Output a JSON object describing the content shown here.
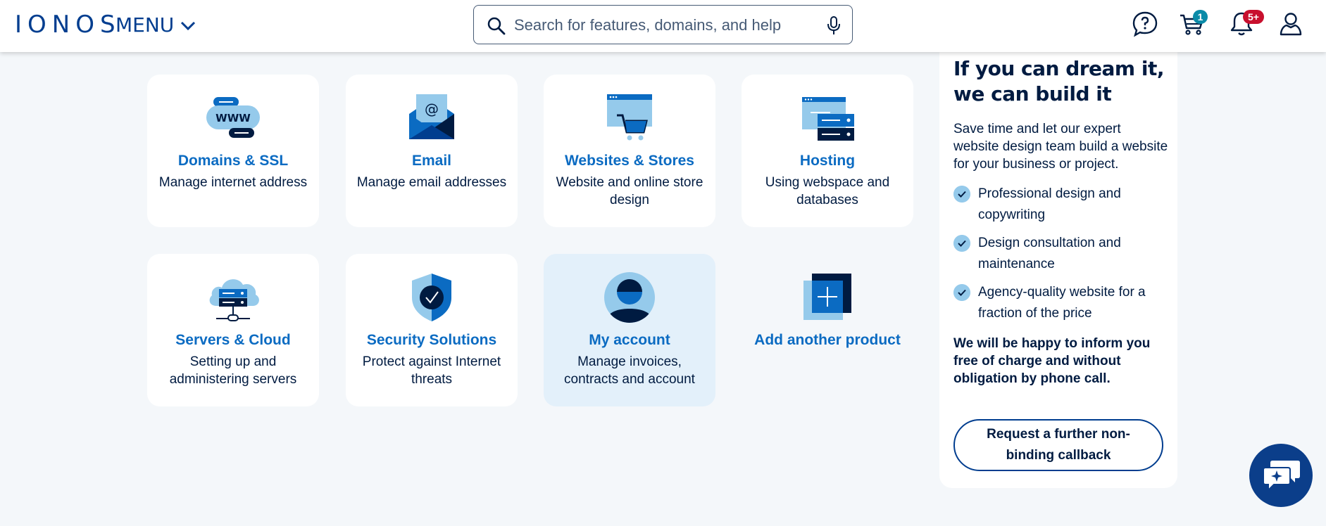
{
  "header": {
    "logo": "IONOS",
    "menu_label": "MENU",
    "search_placeholder": "Search for features, domains, and help",
    "cart_badge": "1",
    "notifications_badge": "5+"
  },
  "tiles": [
    {
      "title": "Domains & SSL",
      "desc": "Manage internet address",
      "icon": "domains-icon"
    },
    {
      "title": "Email",
      "desc": "Manage email addresses",
      "icon": "email-icon"
    },
    {
      "title": "Websites & Stores",
      "desc": "Website and online store design",
      "icon": "website-store-icon"
    },
    {
      "title": "Hosting",
      "desc": "Using webspace and databases",
      "icon": "hosting-icon"
    },
    {
      "title": "Servers & Cloud",
      "desc": "Setting up and administering servers",
      "icon": "server-cloud-icon"
    },
    {
      "title": "Security Solutions",
      "desc": "Protect against Internet threats",
      "icon": "security-shield-icon"
    },
    {
      "title": "My account",
      "desc": "Manage invoices, contracts and account",
      "icon": "account-icon"
    },
    {
      "title": "Add another product",
      "desc": "",
      "icon": "add-product-icon"
    }
  ],
  "promo": {
    "heading": "If you can dream it, we can build it",
    "intro": "Save time and let our expert website design team build a website for your business or project.",
    "bullets": [
      "Professional design and copywriting",
      "Design consultation and maintenance",
      "Agency-quality website for a fraction of the price"
    ],
    "bold_text": "We will be happy to inform you free of charge and without obligation by phone call.",
    "cta_label": "Request a further non-binding callback"
  },
  "colors": {
    "brand_dark": "#003d8f",
    "link_blue": "#0b6bc2",
    "light_blue": "#95caeb",
    "background": "#f4f7fa"
  }
}
